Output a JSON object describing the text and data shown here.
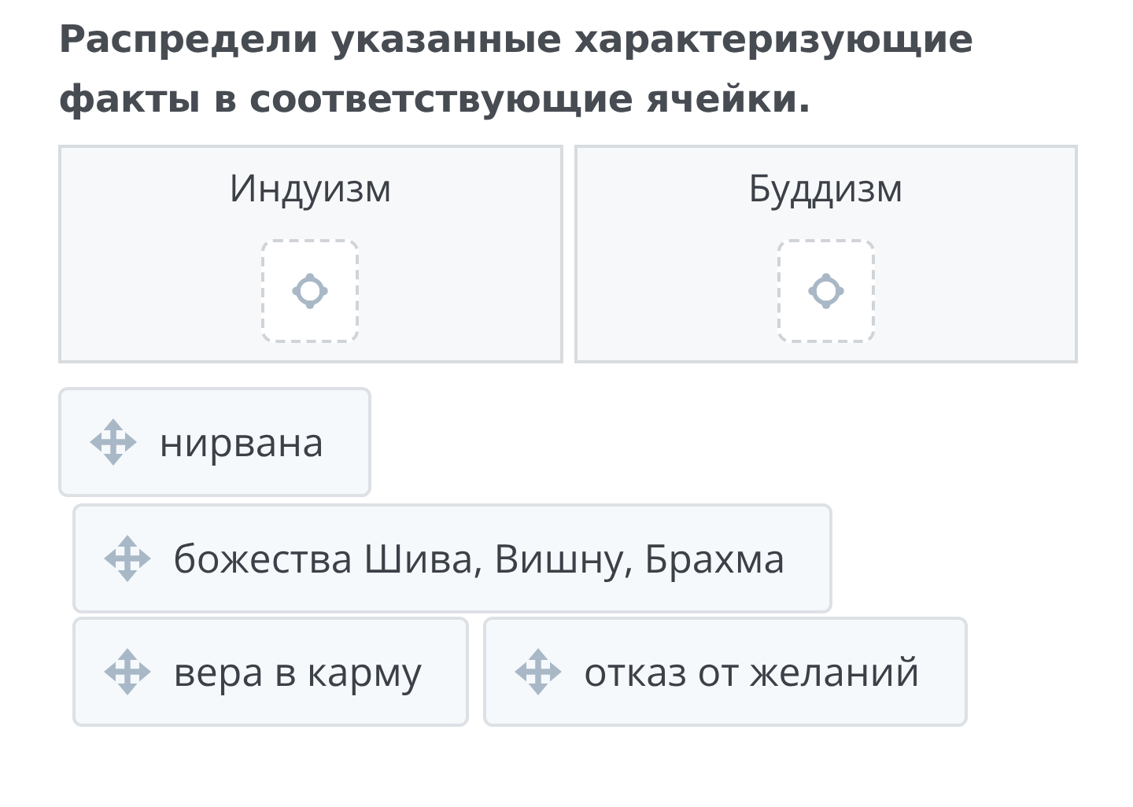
{
  "instruction": "Распредели указанные характеризующие факты в соответствующие ячейки.",
  "categories": [
    {
      "label": "Индуизм"
    },
    {
      "label": "Буддизм"
    }
  ],
  "cards": [
    {
      "label": "нирвана"
    },
    {
      "label": "божества Шива, Вишну, Брахма"
    },
    {
      "label": "вера в карму"
    },
    {
      "label": "отказ от желаний"
    }
  ]
}
